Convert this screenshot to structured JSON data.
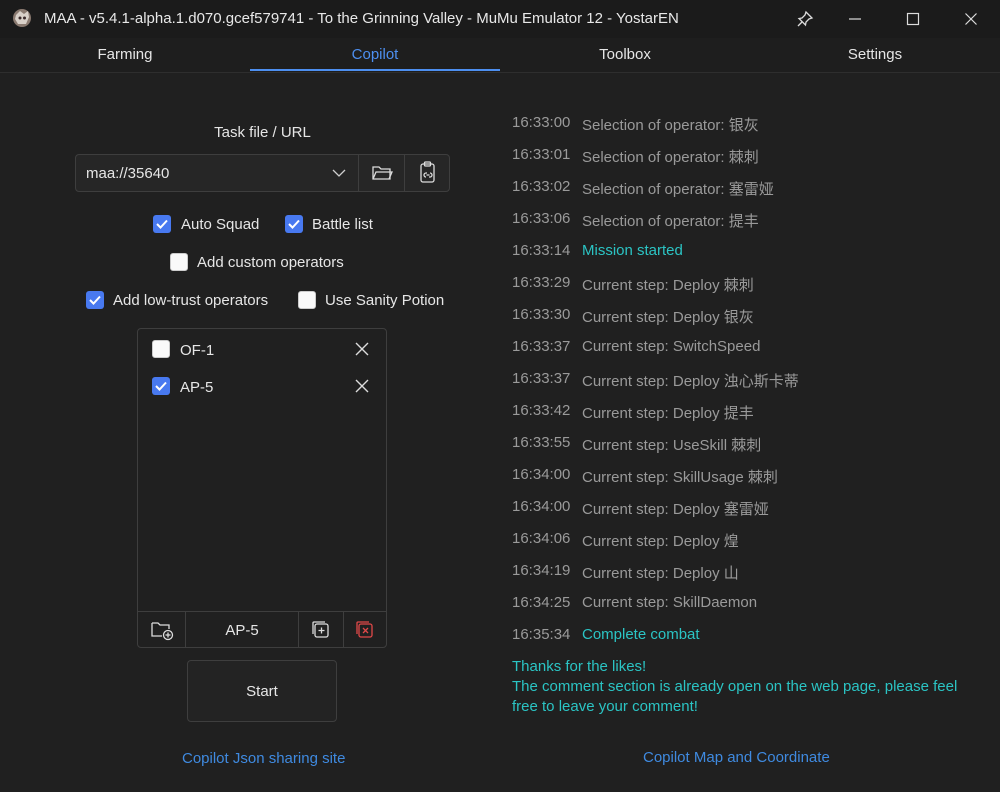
{
  "window": {
    "title": "MAA - v5.4.1-alpha.1.d070.gcef579741 - To the Grinning Valley - MuMu Emulator 12 - YostarEN",
    "icons": [
      "app-icon",
      "pin-icon",
      "minimize-icon",
      "maximize-icon",
      "close-icon"
    ]
  },
  "tabs": [
    {
      "label": "Farming"
    },
    {
      "label": "Copilot",
      "active": true
    },
    {
      "label": "Toolbox"
    },
    {
      "label": "Settings"
    }
  ],
  "copilot": {
    "task_label": "Task file / URL",
    "task_value": "maa://35640",
    "options": {
      "auto_squad": {
        "label": "Auto Squad",
        "checked": true
      },
      "battle_list": {
        "label": "Battle list",
        "checked": true
      },
      "add_custom_operators": {
        "label": "Add custom operators",
        "checked": false
      },
      "add_low_trust": {
        "label": "Add low-trust operators",
        "checked": true
      },
      "use_sanity_potion": {
        "label": "Use Sanity Potion",
        "checked": false
      }
    },
    "stages": [
      {
        "name": "OF-1",
        "checked": false
      },
      {
        "name": "AP-5",
        "checked": true
      }
    ],
    "current_stage": "AP-5",
    "start_label": "Start",
    "sharing_link": "Copilot Json sharing site",
    "map_link": "Copilot Map and Coordinate"
  },
  "log": [
    {
      "time": "16:33:00",
      "msg": "Selection of operator: 银灰",
      "color": "#9a9a9a"
    },
    {
      "time": "16:33:01",
      "msg": "Selection of operator: 棘刺",
      "color": "#9a9a9a"
    },
    {
      "time": "16:33:02",
      "msg": "Selection of operator: 塞雷娅",
      "color": "#9a9a9a"
    },
    {
      "time": "16:33:06",
      "msg": "Selection of operator: 提丰",
      "color": "#9a9a9a"
    },
    {
      "time": "16:33:14",
      "msg": "Mission started",
      "color": "#2bc4c4"
    },
    {
      "time": "16:33:29",
      "msg": "Current step: Deploy 棘刺",
      "color": "#9a9a9a"
    },
    {
      "time": "16:33:30",
      "msg": "Current step: Deploy 银灰",
      "color": "#9a9a9a"
    },
    {
      "time": "16:33:37",
      "msg": "Current step: SwitchSpeed",
      "color": "#9a9a9a"
    },
    {
      "time": "16:33:37",
      "msg": "Current step: Deploy 浊心斯卡蒂",
      "color": "#9a9a9a"
    },
    {
      "time": "16:33:42",
      "msg": "Current step: Deploy 提丰",
      "color": "#9a9a9a"
    },
    {
      "time": "16:33:55",
      "msg": "Current step: UseSkill 棘刺",
      "color": "#9a9a9a"
    },
    {
      "time": "16:34:00",
      "msg": "Current step: SkillUsage 棘刺",
      "color": "#9a9a9a"
    },
    {
      "time": "16:34:00",
      "msg": "Current step: Deploy 塞雷娅",
      "color": "#9a9a9a"
    },
    {
      "time": "16:34:06",
      "msg": "Current step: Deploy 煌",
      "color": "#9a9a9a"
    },
    {
      "time": "16:34:19",
      "msg": "Current step: Deploy 山",
      "color": "#9a9a9a"
    },
    {
      "time": "16:34:25",
      "msg": "Current step: SkillDaemon",
      "color": "#9a9a9a"
    },
    {
      "time": "16:35:34",
      "msg": "Complete combat",
      "color": "#2bc4c4"
    }
  ],
  "log_note": "Thanks for the likes!\nThe comment section is already open on the web page, please feel free to leave your comment!",
  "colors": {
    "accent": "#4d8ff0",
    "log_highlight": "#2bc4c4",
    "link": "#3f8ae0",
    "checkbox": "#4879f0"
  }
}
